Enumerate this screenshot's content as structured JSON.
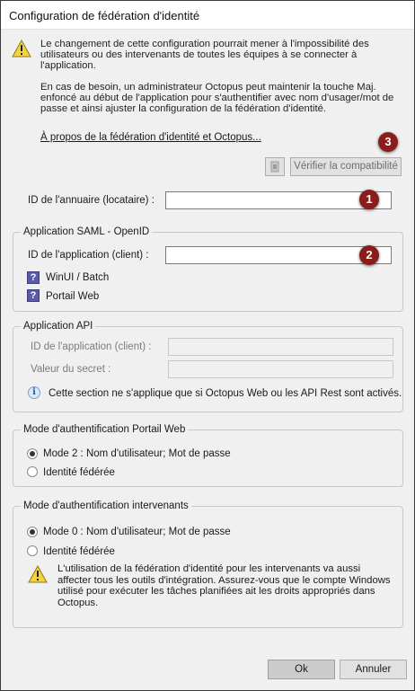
{
  "window": {
    "title": "Configuration de fédération d'identité"
  },
  "warning": {
    "paragraph1": "Le changement de cette configuration pourrait mener à l'impossibilité des utilisateurs ou des intervenants de toutes les équipes à se connecter à l'application.",
    "paragraph2": "En cas de besoin, un administrateur Octopus peut maintenir la touche Maj. enfoncé au début de l'application pour s'authentifier avec nom d'usager/mot de passe et ainsi ajuster la configuration de la fédération d'identité.",
    "link": "À propos de la fédération d'identité et Octopus..."
  },
  "compat": {
    "button": "Vérifier la compatibilité",
    "badge": "3"
  },
  "directory": {
    "label": "ID de l'annuaire (locataire) :",
    "value": "",
    "badge": "1"
  },
  "saml": {
    "legend": "Application SAML - OpenID",
    "client_label": "ID de l'application (client) :",
    "client_value": "",
    "badge": "2",
    "items": [
      {
        "label": "WinUI / Batch"
      },
      {
        "label": "Portail Web"
      }
    ]
  },
  "api": {
    "legend": "Application API",
    "client_label": "ID de l'application (client) :",
    "secret_label": "Valeur du secret :",
    "info": "Cette section ne s'applique que si Octopus Web ou les API Rest sont activés."
  },
  "web_auth": {
    "legend": "Mode d'authentification Portail Web",
    "options": [
      {
        "label": "Mode 2 : Nom d'utilisateur; Mot de passe",
        "checked": true
      },
      {
        "label": "Identité fédérée",
        "checked": false
      }
    ]
  },
  "agent_auth": {
    "legend": "Mode d'authentification intervenants",
    "options": [
      {
        "label": "Mode 0 : Nom d'utilisateur; Mot de passe",
        "checked": true
      },
      {
        "label": "Identité fédérée",
        "checked": false
      }
    ],
    "warning": "L'utilisation de la fédération d'identité pour les intervenants va aussi affecter tous les outils d'intégration. Assurez-vous que le compte Windows utilisé pour exécuter les tâches planifiées ait les droits appropriés dans Octopus."
  },
  "footer": {
    "ok": "Ok",
    "cancel": "Annuler"
  },
  "colors": {
    "badge": "#8b1c1c",
    "window_bg": "#f0f0f0",
    "warning_yellow": "#f5d33a"
  },
  "icons": {
    "warning": "warning-icon",
    "info": "info-icon",
    "question": "question-icon",
    "compat": "compat-icon"
  }
}
